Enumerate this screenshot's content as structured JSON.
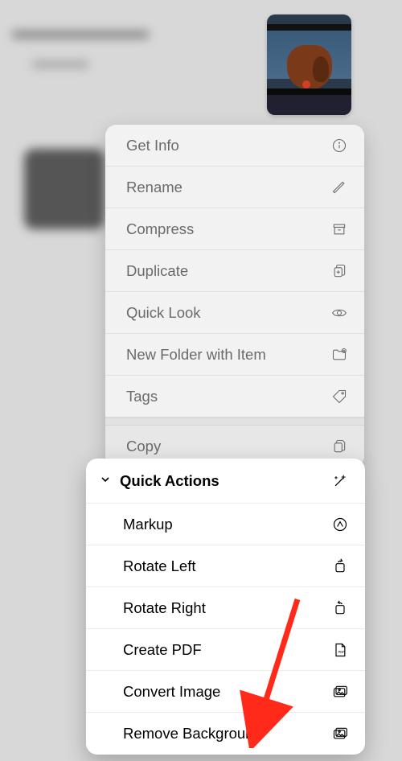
{
  "thumbnail_alt": "dog-in-car-window-photo",
  "context_menu": {
    "items": [
      {
        "label": "Get Info",
        "icon": "info-icon"
      },
      {
        "label": "Rename",
        "icon": "pencil-icon"
      },
      {
        "label": "Compress",
        "icon": "archivebox-icon"
      },
      {
        "label": "Duplicate",
        "icon": "duplicate-icon"
      },
      {
        "label": "Quick Look",
        "icon": "eye-icon"
      },
      {
        "label": "New Folder with Item",
        "icon": "folder-plus-icon"
      },
      {
        "label": "Tags",
        "icon": "tag-icon"
      }
    ],
    "copy": {
      "label": "Copy",
      "icon": "copy-icon"
    }
  },
  "quick_actions": {
    "title": "Quick Actions",
    "header_icon": "sparkles-icon",
    "items": [
      {
        "label": "Markup",
        "icon": "markup-icon"
      },
      {
        "label": "Rotate Left",
        "icon": "rotate-left-icon"
      },
      {
        "label": "Rotate Right",
        "icon": "rotate-right-icon"
      },
      {
        "label": "Create PDF",
        "icon": "pdf-icon"
      },
      {
        "label": "Convert Image",
        "icon": "gallery-icon"
      },
      {
        "label": "Remove Background",
        "icon": "gallery-icon"
      }
    ]
  },
  "annotation": "arrow-to-remove-background"
}
